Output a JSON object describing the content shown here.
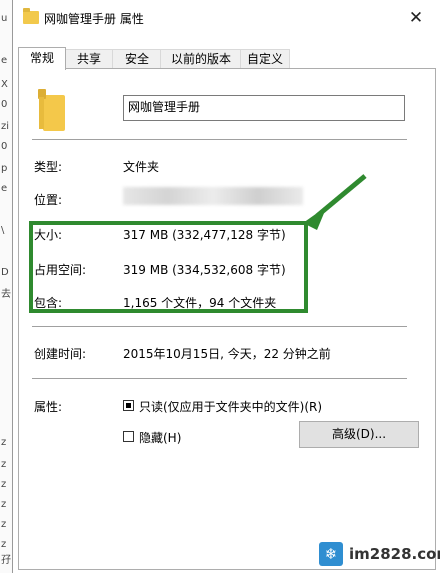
{
  "window": {
    "title": "网咖管理手册 属性",
    "close_icon": "✕"
  },
  "tabs": [
    "常规",
    "共享",
    "安全",
    "以前的版本",
    "自定义"
  ],
  "active_tab": "常规",
  "folder_name": "网咖管理手册",
  "details": {
    "type_label": "类型:",
    "type_value": "文件夹",
    "location_label": "位置:",
    "size_label": "大小:",
    "size_value": "317 MB (332,477,128 字节)",
    "disk_label": "占用空间:",
    "disk_value": "319 MB (334,532,608 字节)",
    "contains_label": "包含:",
    "contains_value": "1,165 个文件，94 个文件夹",
    "created_label": "创建时间:",
    "created_value": "2015年10月15日, 今天，22 分钟之前"
  },
  "attributes": {
    "label": "属性:",
    "readonly_label": "只读(仅应用于文件夹中的文件)(R)",
    "readonly_state": "indeterminate",
    "hidden_label": "隐藏(H)",
    "hidden_state": "unchecked",
    "advanced_button": "高级(D)..."
  },
  "background_chars": [
    "u",
    "e",
    "X",
    "0",
    "zi",
    "0",
    "p",
    "e",
    "\\",
    "D",
    "去",
    "z",
    "z",
    "z",
    "z",
    "z",
    "z",
    "孖",
    "z",
    "迹"
  ],
  "watermark": {
    "text": "im2828.com",
    "logo_icon": "❄"
  },
  "colors": {
    "highlight_box": "#2f8a2f",
    "arrow": "#2f8a2f",
    "folder": "#f4c84a",
    "watermark_logo": "#2f8ed1"
  }
}
